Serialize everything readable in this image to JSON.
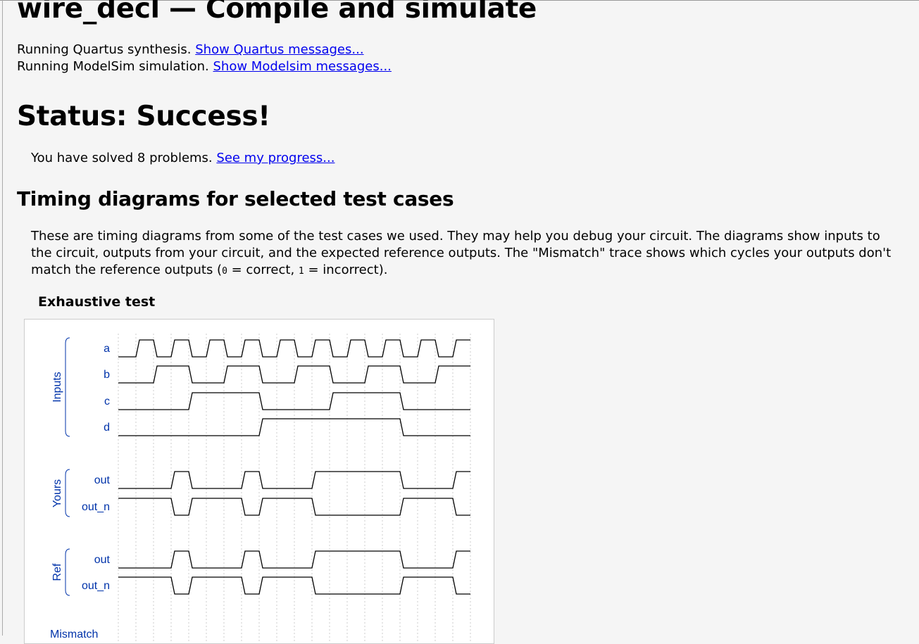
{
  "page": {
    "title": "wire_decl — Compile and simulate",
    "quartus_text": "Running Quartus synthesis.",
    "quartus_link": "Show Quartus messages...",
    "modelsim_text": "Running ModelSim simulation.",
    "modelsim_link": "Show Modelsim messages...",
    "status": "Status: Success!",
    "solved_text": "You have solved 8 problems.",
    "progress_link": "See my progress...",
    "timing_heading": "Timing diagrams for selected test cases",
    "desc_part1": "These are timing diagrams from some of the test cases we used. They may help you debug your circuit. The diagrams show inputs to the circuit, outputs from your circuit, and the expected reference outputs. The \"Mismatch\" trace shows which cycles your outputs don't match the reference outputs (",
    "desc_code0": "0",
    "desc_part2": " = correct, ",
    "desc_code1": "1",
    "desc_part3": " = incorrect).",
    "exhaustive_title": "Exhaustive test"
  },
  "timing": {
    "colors": {
      "label": "#0033aa",
      "wave": "#000000",
      "grid": "#cccccc"
    },
    "groups": [
      {
        "name": "Inputs"
      },
      {
        "name": "Yours"
      },
      {
        "name": "Ref"
      },
      {
        "name": "Mismatch"
      }
    ],
    "signals": [
      {
        "name": "a",
        "group": "Inputs",
        "values": [
          0,
          1,
          0,
          1,
          0,
          1,
          0,
          1,
          0,
          1,
          0,
          1,
          0,
          1,
          0,
          1,
          0,
          1,
          0,
          1
        ]
      },
      {
        "name": "b",
        "group": "Inputs",
        "values": [
          0,
          0,
          1,
          1,
          0,
          0,
          1,
          1,
          0,
          0,
          1,
          1,
          0,
          0,
          1,
          1,
          0,
          0,
          1,
          1
        ]
      },
      {
        "name": "c",
        "group": "Inputs",
        "values": [
          0,
          0,
          0,
          0,
          1,
          1,
          1,
          1,
          0,
          0,
          0,
          0,
          1,
          1,
          1,
          1,
          0,
          0,
          0,
          0
        ]
      },
      {
        "name": "d",
        "group": "Inputs",
        "values": [
          0,
          0,
          0,
          0,
          0,
          0,
          0,
          0,
          1,
          1,
          1,
          1,
          1,
          1,
          1,
          1,
          0,
          0,
          0,
          0
        ]
      },
      {
        "name": "out",
        "group": "Yours",
        "values": [
          0,
          0,
          0,
          1,
          0,
          0,
          0,
          1,
          0,
          0,
          0,
          1,
          1,
          1,
          1,
          1,
          0,
          0,
          0,
          1
        ]
      },
      {
        "name": "out_n",
        "group": "Yours",
        "values": [
          1,
          1,
          1,
          0,
          1,
          1,
          1,
          0,
          1,
          1,
          1,
          0,
          0,
          0,
          0,
          0,
          1,
          1,
          1,
          0
        ]
      },
      {
        "name": "out",
        "group": "Ref",
        "values": [
          0,
          0,
          0,
          1,
          0,
          0,
          0,
          1,
          0,
          0,
          0,
          1,
          1,
          1,
          1,
          1,
          0,
          0,
          0,
          1
        ]
      },
      {
        "name": "out_n",
        "group": "Ref",
        "values": [
          1,
          1,
          1,
          0,
          1,
          1,
          1,
          0,
          1,
          1,
          1,
          0,
          0,
          0,
          0,
          0,
          1,
          1,
          1,
          0
        ]
      }
    ],
    "mismatch_label": "Mismatch"
  }
}
